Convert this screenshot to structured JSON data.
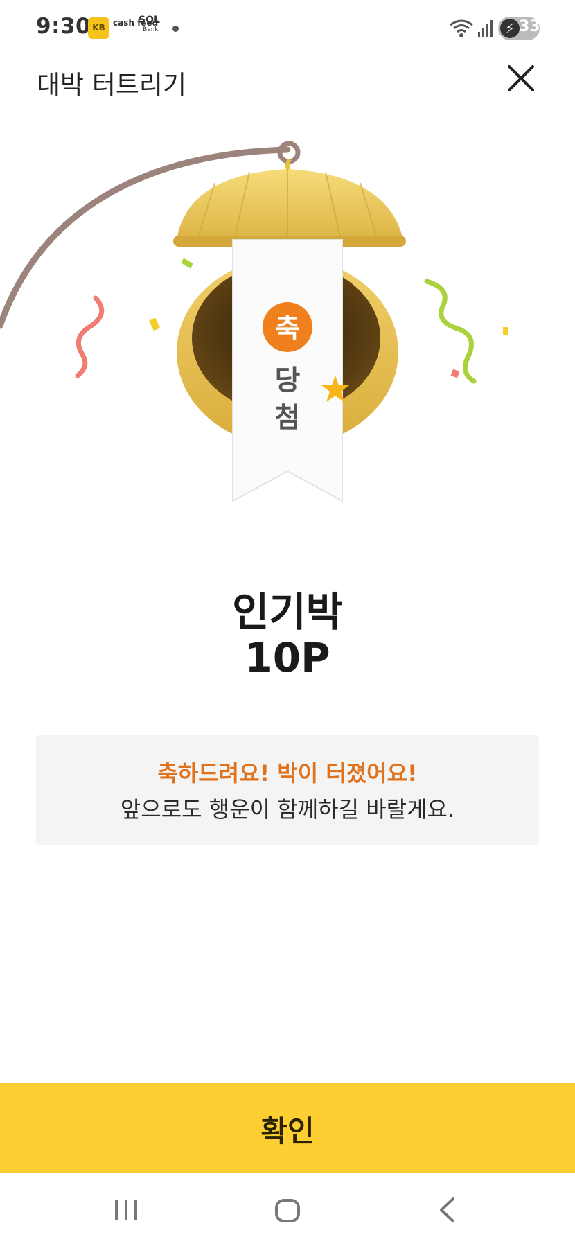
{
  "status_bar": {
    "time": "9:30",
    "apps": {
      "kb": "KB",
      "cashfeed": "cash feed",
      "sol": "SOL",
      "sol_sub": "Bank"
    },
    "battery_level": "33",
    "icons": [
      "wifi-icon",
      "signal-icon",
      "battery-charging-icon"
    ]
  },
  "header": {
    "title": "대박 터트리기",
    "close_icon": "close-icon"
  },
  "illustration": {
    "ribbon_badge": "축",
    "ribbon_text": "당첨",
    "icons": [
      "gourd-icon",
      "ribbon-icon",
      "star-icon",
      "confetti-icon"
    ]
  },
  "prize": {
    "title": "인기박",
    "amount": "10P"
  },
  "message": {
    "highlight": "축하드려요! 박이 터졌어요!",
    "body": "앞으로도 행운이 함께하길 바랄게요."
  },
  "confirm": {
    "label": "확인"
  },
  "colors": {
    "accent_button": "#fdcf32",
    "highlight_text": "#e0721c",
    "badge_orange": "#f0801e",
    "gourd_gold": "#e9c45a"
  }
}
